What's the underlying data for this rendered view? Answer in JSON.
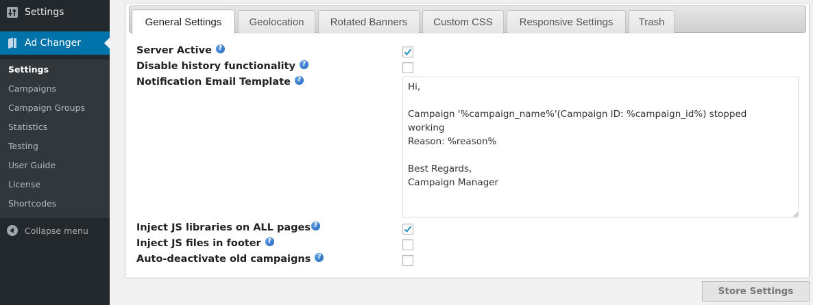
{
  "sidebar": {
    "settings_label": "Settings",
    "plugin_label": "Ad Changer",
    "submenu": [
      {
        "label": "Settings",
        "current": true
      },
      {
        "label": "Campaigns"
      },
      {
        "label": "Campaign Groups"
      },
      {
        "label": "Statistics"
      },
      {
        "label": "Testing"
      },
      {
        "label": "User Guide"
      },
      {
        "label": "License"
      },
      {
        "label": "Shortcodes"
      }
    ],
    "collapse_label": "Collapse menu"
  },
  "tabs": [
    {
      "label": "General Settings",
      "active": true
    },
    {
      "label": "Geolocation"
    },
    {
      "label": "Rotated Banners"
    },
    {
      "label": "Custom CSS"
    },
    {
      "label": "Responsive Settings"
    },
    {
      "label": "Trash"
    }
  ],
  "settings": {
    "server_active": {
      "label": "Server Active",
      "checked": true
    },
    "disable_history": {
      "label": "Disable history functionality",
      "checked": false
    },
    "notification_email": {
      "label": "Notification Email Template",
      "value": "Hi,\n\nCampaign '%campaign_name%'(Campaign ID: %campaign_id%) stopped\nworking\nReason: %reason%\n\nBest Regards,\nCampaign Manager"
    },
    "inject_js_all": {
      "label": "Inject JS libraries on ALL pages",
      "checked": true
    },
    "inject_js_footer": {
      "label": "Inject JS files in footer",
      "checked": false
    },
    "auto_deactivate": {
      "label": "Auto-deactivate old campaigns",
      "checked": false
    }
  },
  "help_glyph": "?",
  "store_button": "Store Settings",
  "colors": {
    "sidebar_bg": "#23282d",
    "submenu_bg": "#32373c",
    "accent": "#0073aa",
    "check": "#1e8cbe"
  }
}
